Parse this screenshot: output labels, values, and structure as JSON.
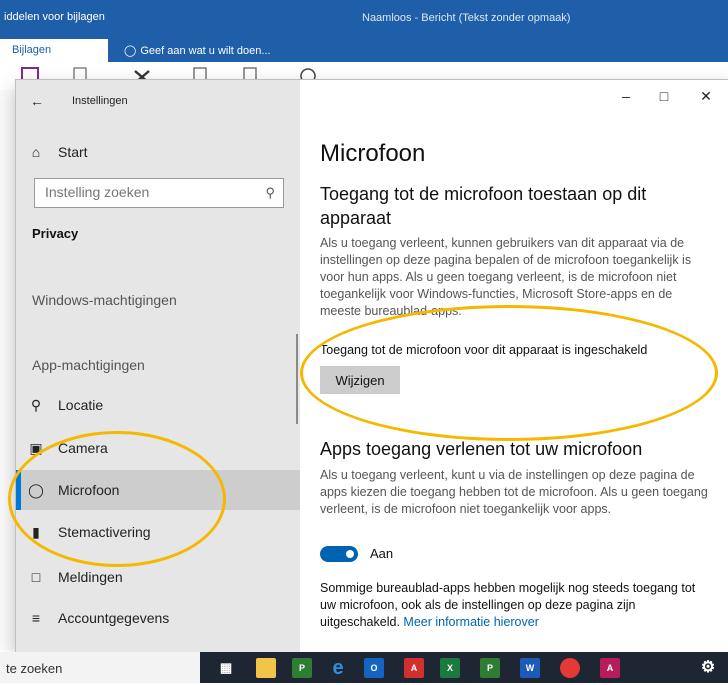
{
  "outlook": {
    "title_left": "iddelen voor bijlagen",
    "title_center": "Naamloos - Bericht (Tekst zonder opmaak)",
    "tab_active": "Bijlagen",
    "tell_me": "Geef aan wat u wilt doen..."
  },
  "settings": {
    "window_title": "Instellingen",
    "nav": {
      "start": "Start",
      "search_placeholder": "Instelling zoeken",
      "section_privacy": "Privacy",
      "section_windows": "Windows-machtigingen",
      "section_app": "App-machtigingen",
      "items": [
        {
          "label": "Locatie",
          "icon": "location-icon"
        },
        {
          "label": "Camera",
          "icon": "camera-icon"
        },
        {
          "label": "Microfoon",
          "icon": "microphone-icon",
          "selected": true
        },
        {
          "label": "Stemactivering",
          "icon": "voice-activation-icon"
        },
        {
          "label": "Meldingen",
          "icon": "notifications-icon"
        },
        {
          "label": "Accountgegevens",
          "icon": "account-info-icon"
        }
      ]
    },
    "content": {
      "heading": "Microfoon",
      "device_heading": "Toegang tot de microfoon toestaan op dit apparaat",
      "device_description": "Als u toegang verleent, kunnen gebruikers van dit apparaat via de instellingen op deze pagina bepalen of de microfoon toegankelijk is voor hun apps. Als u geen toegang verleent, is de microfoon niet toegankelijk voor Windows-functies, Microsoft Store-apps en de meeste bureaublad-apps.",
      "device_status": "Toegang tot de microfoon voor dit apparaat is ingeschakeld",
      "change_button": "Wijzigen",
      "apps_heading": "Apps toegang verlenen tot uw microfoon",
      "apps_description": "Als u toegang verleent, kunt u via de instellingen op deze pagina de apps kiezen die toegang hebben tot de microfoon. Als u geen toegang verleent, is de microfoon niet toegankelijk voor apps.",
      "toggle_state": "Aan",
      "toggle_on": true,
      "footer_text": "Sommige bureaublad-apps hebben mogelijk nog steeds toegang tot uw microfoon, ook als de instellingen op deze pagina zijn uitgeschakeld.",
      "footer_link": "Meer informatie hierover"
    }
  },
  "taskbar": {
    "search_text": "te zoeken",
    "apps": [
      "task-view-icon",
      "file-explorer-icon",
      "project-icon",
      "edge-icon",
      "outlook-icon",
      "acrobat-icon",
      "excel-icon",
      "project-planner-icon",
      "word-icon",
      "chrome-icon",
      "access-icon",
      "settings-gear-icon"
    ]
  },
  "colors": {
    "accent": "#0078d7",
    "outlook_blue": "#1f5ea8",
    "annotation": "#f5b800"
  }
}
